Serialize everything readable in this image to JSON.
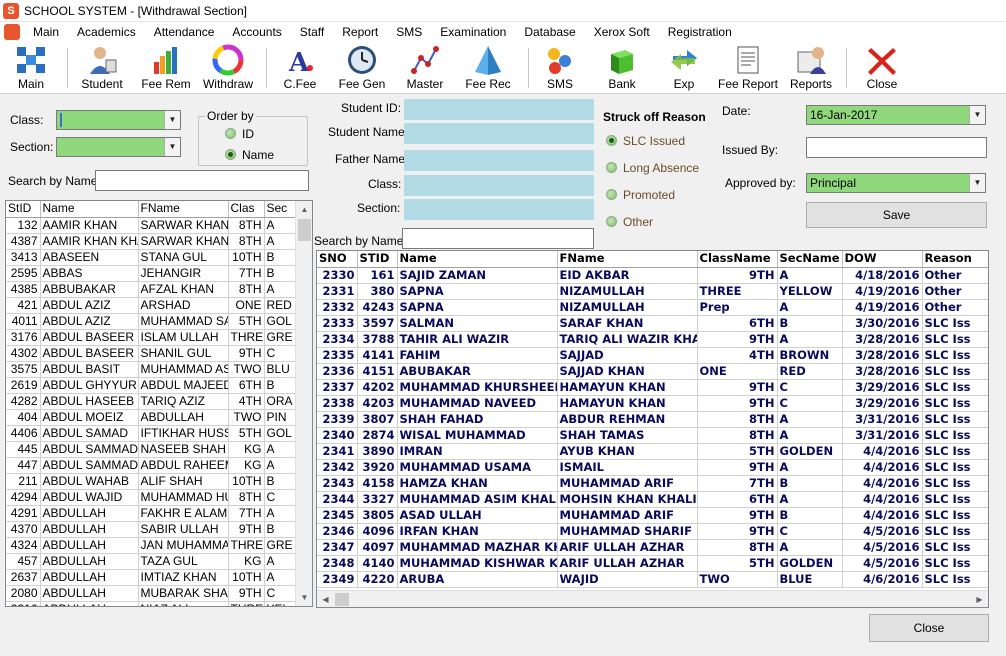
{
  "window": {
    "title": "SCHOOL SYSTEM - [Withdrawal Section]"
  },
  "menu": [
    "Main",
    "Academics",
    "Attendance",
    "Accounts",
    "Staff",
    "Report",
    "SMS",
    "Examination",
    "Database",
    "Xerox Soft",
    "Registration"
  ],
  "toolbar": [
    {
      "label": "Main",
      "icon": "grid-icon"
    },
    {
      "label": "Student",
      "icon": "student-icon"
    },
    {
      "label": "Fee Rem",
      "icon": "bar-chart-icon"
    },
    {
      "label": "Withdraw",
      "icon": "color-wheel-icon"
    },
    {
      "label": "C.Fee",
      "icon": "font-icon"
    },
    {
      "label": "Fee Gen",
      "icon": "clock-icon"
    },
    {
      "label": "Master",
      "icon": "line-graph-icon"
    },
    {
      "label": "Fee Rec",
      "icon": "pyramid-icon"
    },
    {
      "label": "SMS",
      "icon": "balls-icon"
    },
    {
      "label": "Bank",
      "icon": "cube-icon"
    },
    {
      "label": "Exp",
      "icon": "arrows-icon"
    },
    {
      "label": "Fee Report",
      "icon": "document-icon"
    },
    {
      "label": "Reports",
      "icon": "reports-icon"
    },
    {
      "label": "Close",
      "icon": "close-x-icon"
    }
  ],
  "left": {
    "class_label": "Class:",
    "class_value": "",
    "section_label": "Section:",
    "section_value": "",
    "order_by": {
      "title": "Order by",
      "id_label": "ID",
      "name_label": "Name",
      "selected": "Name"
    },
    "search_label": "Search by Name:",
    "search_value": "",
    "grid": {
      "headers": [
        "StID",
        "Name",
        "FName",
        "Clas",
        "Sec"
      ],
      "rows": [
        [
          "132",
          "AAMIR KHAN",
          "SARWAR KHAN",
          "8TH",
          "A"
        ],
        [
          "4387",
          "AAMIR KHAN KHA",
          "SARWAR KHAN I",
          "8TH",
          "A"
        ],
        [
          "3413",
          "ABASEEN",
          "STANA GUL",
          "10TH",
          "B"
        ],
        [
          "2595",
          "ABBAS",
          "JEHANGIR",
          "7TH",
          "B"
        ],
        [
          "4385",
          "ABBUBAKAR",
          "AFZAL KHAN",
          "8TH",
          "A"
        ],
        [
          "421",
          "ABDUL AZIZ",
          "ARSHAD",
          "ONE",
          "RED"
        ],
        [
          "4011",
          "ABDUL AZIZ",
          "MUHAMMAD SAE",
          "5TH",
          "GOL"
        ],
        [
          "3176",
          "ABDUL BASEER",
          "ISLAM ULLAH",
          "THRE",
          "GRE"
        ],
        [
          "4302",
          "ABDUL BASEER",
          "SHANIL GUL",
          "9TH",
          "C"
        ],
        [
          "3575",
          "ABDUL BASIT",
          "MUHAMMAD ASI",
          "TWO",
          "BLU"
        ],
        [
          "2619",
          "ABDUL GHYYUR A",
          "ABDUL MAJEED .",
          "6TH",
          "B"
        ],
        [
          "4282",
          "ABDUL HASEEB",
          "TARIQ AZIZ",
          "4TH",
          "ORA"
        ],
        [
          "404",
          "ABDUL MOEIZ",
          "ABDULLAH",
          "TWO",
          "PIN"
        ],
        [
          "4406",
          "ABDUL SAMAD",
          "IFTIKHAR HUSS/",
          "5TH",
          "GOL"
        ],
        [
          "445",
          "ABDUL SAMMAD",
          "NASEEB SHAH",
          "KG",
          "A"
        ],
        [
          "447",
          "ABDUL SAMMAD",
          "ABDUL RAHEEM",
          "KG",
          "A"
        ],
        [
          "211",
          "ABDUL WAHAB",
          "ALIF SHAH",
          "10TH",
          "B"
        ],
        [
          "4294",
          "ABDUL WAJID",
          "MUHAMMAD HU:",
          "8TH",
          "C"
        ],
        [
          "4291",
          "ABDULLAH",
          "FAKHR E ALAM",
          "7TH",
          "A"
        ],
        [
          "4370",
          "ABDULLAH",
          "SABIR ULLAH",
          "9TH",
          "B"
        ],
        [
          "4324",
          "ABDULLAH",
          "JAN MUHAMMAD",
          "THRE",
          "GRE"
        ],
        [
          "457",
          "ABDULLAH",
          "TAZA GUL",
          "KG",
          "A"
        ],
        [
          "2637",
          "ABDULLAH",
          "IMTIAZ KHAN",
          "10TH",
          "A"
        ],
        [
          "2080",
          "ABDULLAH",
          "MUBARAK SHAH",
          "9TH",
          "C"
        ],
        [
          "2316",
          "ABDULLAH",
          "NIAZ ALI",
          "THRE",
          "YEL"
        ]
      ]
    }
  },
  "middle": {
    "student_id_label": "Student ID:",
    "student_name_label": "Student Name",
    "father_name_label": "Father Name",
    "class_label": "Class:",
    "section_label": "Section:",
    "search_label": "Search by Name:",
    "struck_off": {
      "title": "Struck off Reason",
      "options": [
        "SLC Issued",
        "Long Absence",
        "Promoted",
        "Other"
      ],
      "selected": "SLC Issued"
    }
  },
  "right": {
    "date_label": "Date:",
    "date_value": "16-Jan-2017",
    "issued_by_label": "Issued By:",
    "issued_by_value": "",
    "approved_by_label": "Approved by:",
    "approved_by_value": "Principal",
    "save_label": "Save"
  },
  "grid2": {
    "headers": [
      "SNO",
      "STID",
      "Name",
      "FName",
      "ClassName",
      "SecName",
      "DOW",
      "Reason"
    ],
    "rows": [
      [
        "2330",
        "161",
        "SAJID ZAMAN",
        "EID AKBAR",
        "9TH",
        "A",
        "4/18/2016",
        "Other"
      ],
      [
        "2331",
        "380",
        "SAPNA",
        "NIZAMULLAH",
        "THREE",
        "YELLOW",
        "4/19/2016",
        "Other"
      ],
      [
        "2332",
        "4243",
        "SAPNA",
        "NIZAMULLAH",
        "Prep",
        "A",
        "4/19/2016",
        "Other"
      ],
      [
        "2333",
        "3597",
        "SALMAN",
        "SARAF KHAN",
        "6TH",
        "B",
        "3/30/2016",
        "SLC Iss"
      ],
      [
        "2334",
        "3788",
        "TAHIR ALI WAZIR",
        "TARIQ ALI WAZIR KHATTA",
        "9TH",
        "A",
        "3/28/2016",
        "SLC Iss"
      ],
      [
        "2335",
        "4141",
        "FAHIM",
        "SAJJAD",
        "4TH",
        "BROWN",
        "3/28/2016",
        "SLC Iss"
      ],
      [
        "2336",
        "4151",
        "ABUBAKAR",
        "SAJJAD KHAN",
        "ONE",
        "RED",
        "3/28/2016",
        "SLC Iss"
      ],
      [
        "2337",
        "4202",
        "MUHAMMAD KHURSHEED",
        "HAMAYUN KHAN",
        "9TH",
        "C",
        "3/29/2016",
        "SLC Iss"
      ],
      [
        "2338",
        "4203",
        "MUHAMMAD NAVEED",
        "HAMAYUN KHAN",
        "9TH",
        "C",
        "3/29/2016",
        "SLC Iss"
      ],
      [
        "2339",
        "3807",
        "SHAH FAHAD",
        "ABDUR REHMAN",
        "8TH",
        "A",
        "3/31/2016",
        "SLC Iss"
      ],
      [
        "2340",
        "2874",
        "WISAL MUHAMMAD",
        "SHAH TAMAS",
        "8TH",
        "A",
        "3/31/2016",
        "SLC Iss"
      ],
      [
        "2341",
        "3890",
        "IMRAN",
        "AYUB KHAN",
        "5TH",
        "GOLDEN",
        "4/4/2016",
        "SLC Iss"
      ],
      [
        "2342",
        "3920",
        "MUHAMMAD USAMA",
        "ISMAIL",
        "9TH",
        "A",
        "4/4/2016",
        "SLC Iss"
      ],
      [
        "2343",
        "4158",
        "HAMZA KHAN",
        "MUHAMMAD ARIF",
        "7TH",
        "B",
        "4/4/2016",
        "SLC Iss"
      ],
      [
        "2344",
        "3327",
        "MUHAMMAD ASIM KHALIL",
        "MOHSIN KHAN KHALIL",
        "6TH",
        "A",
        "4/4/2016",
        "SLC Iss"
      ],
      [
        "2345",
        "3805",
        "ASAD ULLAH",
        "MUHAMMAD ARIF",
        "9TH",
        "B",
        "4/4/2016",
        "SLC Iss"
      ],
      [
        "2346",
        "4096",
        "IRFAN KHAN",
        "MUHAMMAD SHARIF",
        "9TH",
        "C",
        "4/5/2016",
        "SLC Iss"
      ],
      [
        "2347",
        "4097",
        "MUHAMMAD MAZHAR KH/",
        "ARIF ULLAH AZHAR",
        "8TH",
        "A",
        "4/5/2016",
        "SLC Iss"
      ],
      [
        "2348",
        "4140",
        "MUHAMMAD KISHWAR KH",
        "ARIF ULLAH AZHAR",
        "5TH",
        "GOLDEN",
        "4/5/2016",
        "SLC Iss"
      ],
      [
        "2349",
        "4220",
        "ARUBA",
        "WAJID",
        "TWO",
        "BLUE",
        "4/6/2016",
        "SLC Iss"
      ]
    ]
  },
  "close_label": "Close",
  "colors": {
    "accent_green": "#8fd87b",
    "field_blue": "#b3dbe6"
  }
}
